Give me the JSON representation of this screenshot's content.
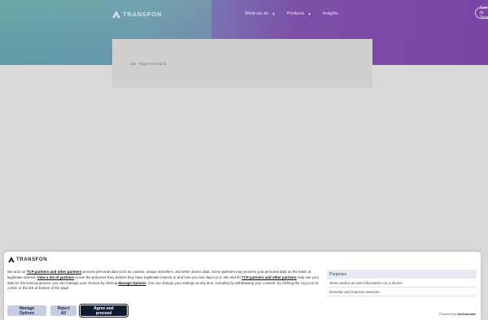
{
  "header": {
    "logo_text": "TRANSFON",
    "nav": [
      {
        "label": "What we do",
        "has_dropdown": true
      },
      {
        "label": "Products",
        "has_dropdown": true
      },
      {
        "label": "Insights",
        "has_dropdown": false
      }
    ],
    "cta_label": "Get In Touch"
  },
  "main": {
    "message": "404 - Page Not Found"
  },
  "consent": {
    "logo_text": "TRANSFON",
    "text": {
      "p1": "We and our ",
      "link1": "TCP partners and other partners",
      "p2": " process personal data such as cookies, unique identifiers, and other device data. Some partners may process your personal data on the basis of legitimate interest. ",
      "link2": "View a list of partners",
      "p3": " to see the purposes they believe they have legitimate interest or and how you can object to it. We and 40 ",
      "link3": "TCP partners and other partners",
      "p4": " may use your data for the listed purposes, you can manage your choices by clicking ",
      "link4": "Manage Options",
      "p5": ". You can change your settings at any time, including by withdrawing your consent, by clicking the cog icon at corner or the link at bottom of the page."
    },
    "purposes": {
      "heading": "Purposes",
      "items": [
        "Store and/or access information on a device",
        "Develop and improve services"
      ]
    },
    "buttons": {
      "manage": "Manage Options",
      "reject": "Reject All",
      "agree": "Agree and proceed"
    },
    "powered_by": {
      "prefix": "Powered by",
      "brand": "UniConsent"
    }
  },
  "colors": {
    "hero_teal": "#5a9aa6",
    "hero_purple": "#7c45a6",
    "agree_bg": "#0f1a2c",
    "secondary_btn_bg": "#c5cde0"
  }
}
